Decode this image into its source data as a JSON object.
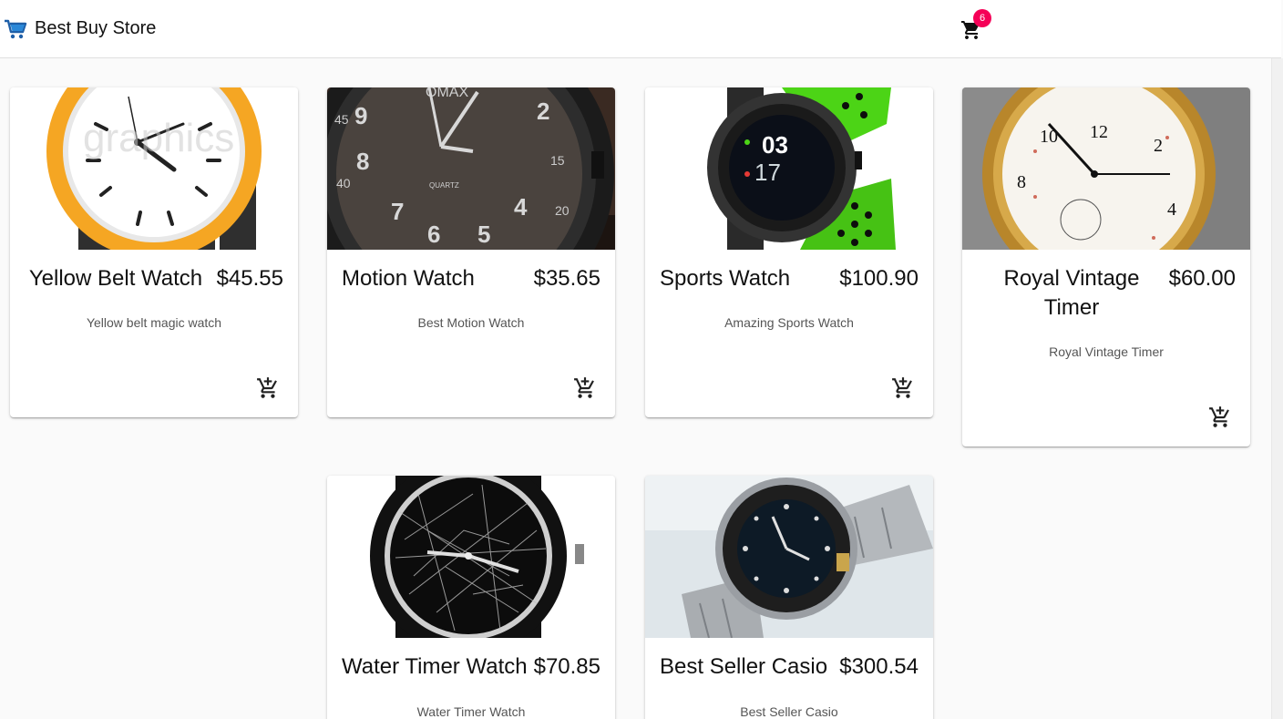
{
  "header": {
    "title": "Best Buy Store",
    "brand_icon": "shopping-cart-icon",
    "cart_icon": "cart-icon",
    "cart_count": "6",
    "badge_color": "#f50057"
  },
  "products": [
    {
      "title": "Yellow Belt Watch",
      "price": "$45.55",
      "description": "Yellow belt magic watch"
    },
    {
      "title": "Motion Watch",
      "price": "$35.65",
      "description": "Best Motion Watch"
    },
    {
      "title": "Sports Watch",
      "price": "$100.90",
      "description": "Amazing Sports Watch"
    },
    {
      "title": "Royal Vintage Timer",
      "price": "$60.00",
      "description": "Royal Vintage Timer"
    },
    {
      "title": "Water Timer Watch",
      "price": "$70.85",
      "description": "Water Timer Watch"
    },
    {
      "title": "Best Seller Casio",
      "price": "$300.54",
      "description": "Best Seller Casio"
    }
  ],
  "add_to_cart_icon": "add-shopping-cart-icon"
}
